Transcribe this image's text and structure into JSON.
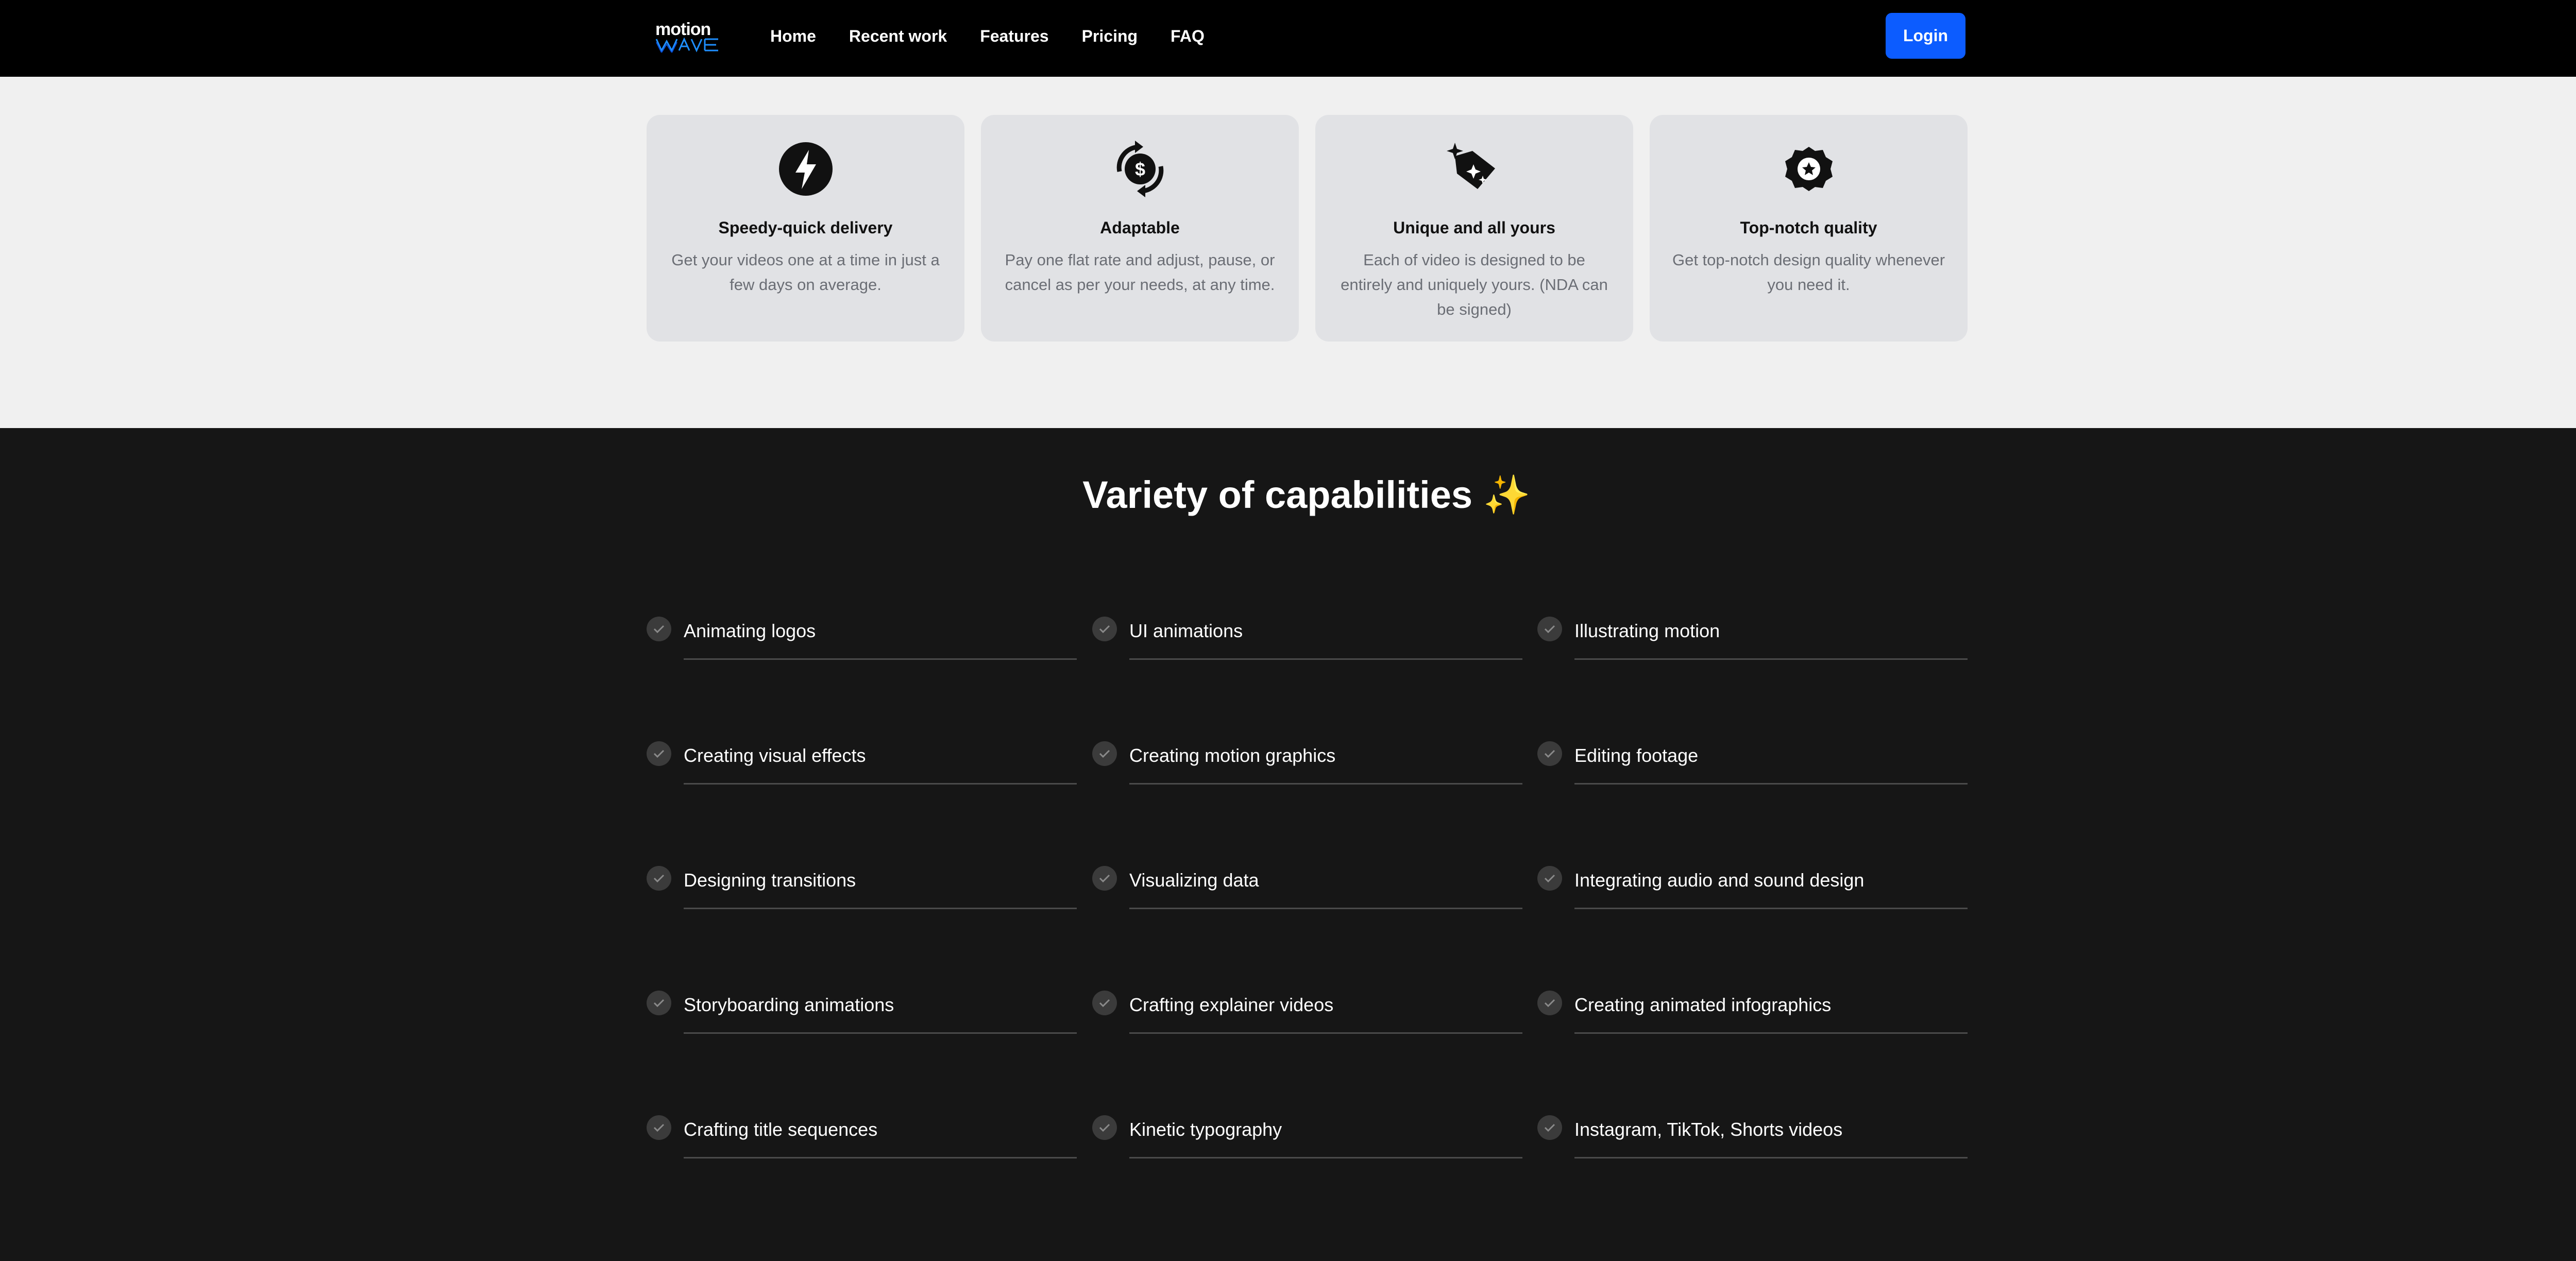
{
  "nav": {
    "logo_text": "motion",
    "logo_sub": "wave",
    "links": [
      "Home",
      "Recent work",
      "Features",
      "Pricing",
      "FAQ"
    ],
    "login_label": "Login",
    "accent_color": "#0c5cff"
  },
  "features": [
    {
      "icon": "lightning-icon",
      "title": "Speedy-quick delivery",
      "desc": "Get your videos one at a time in just a few days on average."
    },
    {
      "icon": "dollar-cycle-icon",
      "title": "Adaptable",
      "desc": "Pay one flat rate and adjust, pause, or cancel as per your needs, at any time."
    },
    {
      "icon": "sparkle-tag-icon",
      "title": "Unique and all yours",
      "desc": "Each of video is designed to be entirely and uniquely yours. (NDA can be signed)"
    },
    {
      "icon": "badge-star-icon",
      "title": "Top-notch quality",
      "desc": "Get top-notch design quality whenever you need it."
    }
  ],
  "capabilities": {
    "heading": "Variety of capabilities",
    "heading_emoji": "✨",
    "items": [
      "Animating logos",
      "UI animations",
      "Illustrating motion",
      "Creating visual effects",
      "Creating motion graphics",
      "Editing footage",
      "Designing transitions",
      "Visualizing data",
      "Integrating audio and sound design",
      "Storyboarding animations",
      "Crafting explainer videos",
      "Creating animated infographics",
      "Crafting title sequences",
      "Kinetic typography",
      "Instagram, TikTok, Shorts videos"
    ]
  }
}
